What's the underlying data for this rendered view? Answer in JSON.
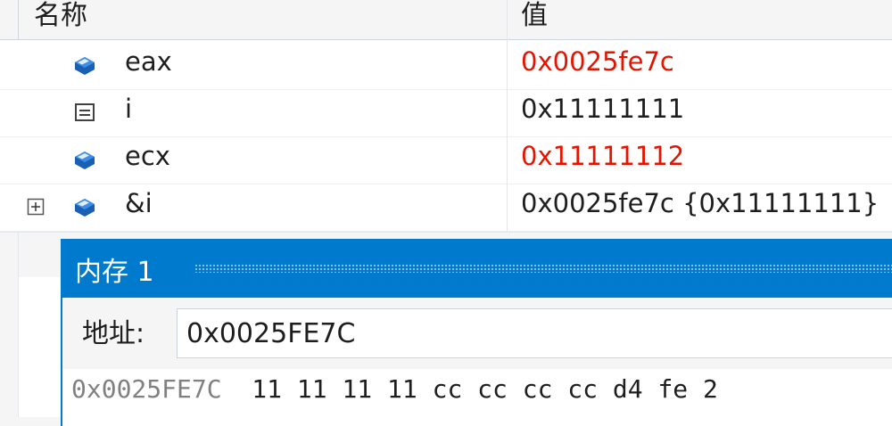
{
  "watch": {
    "columns": {
      "name": "名称",
      "value": "值"
    },
    "rows": [
      {
        "name": "eax",
        "value": "0x0025fe7c",
        "icon": "register-icon",
        "changed": true,
        "expandable": false
      },
      {
        "name": "i",
        "value": "0x11111111",
        "icon": "local-variable-icon",
        "changed": false,
        "expandable": false
      },
      {
        "name": "ecx",
        "value": "0x11111112",
        "icon": "register-icon",
        "changed": true,
        "expandable": false
      },
      {
        "name": "&i",
        "value": "0x0025fe7c {0x11111111}",
        "icon": "register-icon",
        "changed": false,
        "expandable": true
      }
    ]
  },
  "memory": {
    "title": "内存 1",
    "address_label": "地址:",
    "address_value": "0x0025FE7C",
    "lines": [
      {
        "address": "0x0025FE7C",
        "bytes": "11 11 11 11 cc cc cc cc d4 fe 2"
      }
    ]
  },
  "colors": {
    "changed_value": "#e51400",
    "accent": "#007acc",
    "register_icon": "#1a5fb4"
  }
}
